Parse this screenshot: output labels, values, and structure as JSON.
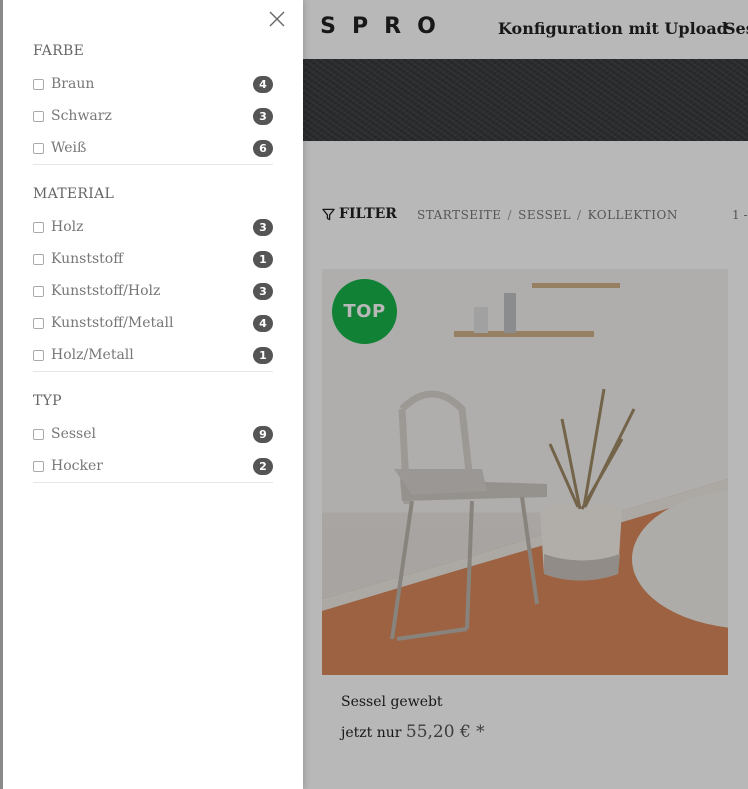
{
  "header": {
    "logo": "ISPRO",
    "nav": [
      "Konfiguration mit Upload",
      "Ses"
    ]
  },
  "listing": {
    "filter_label": "FILTER",
    "breadcrumb": [
      "STARTSEITE",
      "SESSEL",
      "KOLLEKTION"
    ],
    "paging": "1 -"
  },
  "product": {
    "badge": "TOP",
    "name": "Sessel gewebt",
    "price_prefix": "jetzt nur",
    "price": "55,20 € *"
  },
  "filter_panel": {
    "groups": [
      {
        "title": "FARBE",
        "options": [
          {
            "label": "Braun",
            "count": "4"
          },
          {
            "label": "Schwarz",
            "count": "3"
          },
          {
            "label": "Weiß",
            "count": "6"
          }
        ]
      },
      {
        "title": "MATERIAL",
        "options": [
          {
            "label": "Holz",
            "count": "3"
          },
          {
            "label": "Kunststoff",
            "count": "1"
          },
          {
            "label": "Kunststoff/Holz",
            "count": "3"
          },
          {
            "label": "Kunststoff/Metall",
            "count": "4"
          },
          {
            "label": "Holz/Metall",
            "count": "1"
          }
        ]
      },
      {
        "title": "TYP",
        "options": [
          {
            "label": "Sessel",
            "count": "9"
          },
          {
            "label": "Hocker",
            "count": "2"
          }
        ]
      }
    ]
  },
  "colors": {
    "badge_green": "#17b34a",
    "count_pill": "#555555",
    "hero_dark": "#3b3d40"
  }
}
